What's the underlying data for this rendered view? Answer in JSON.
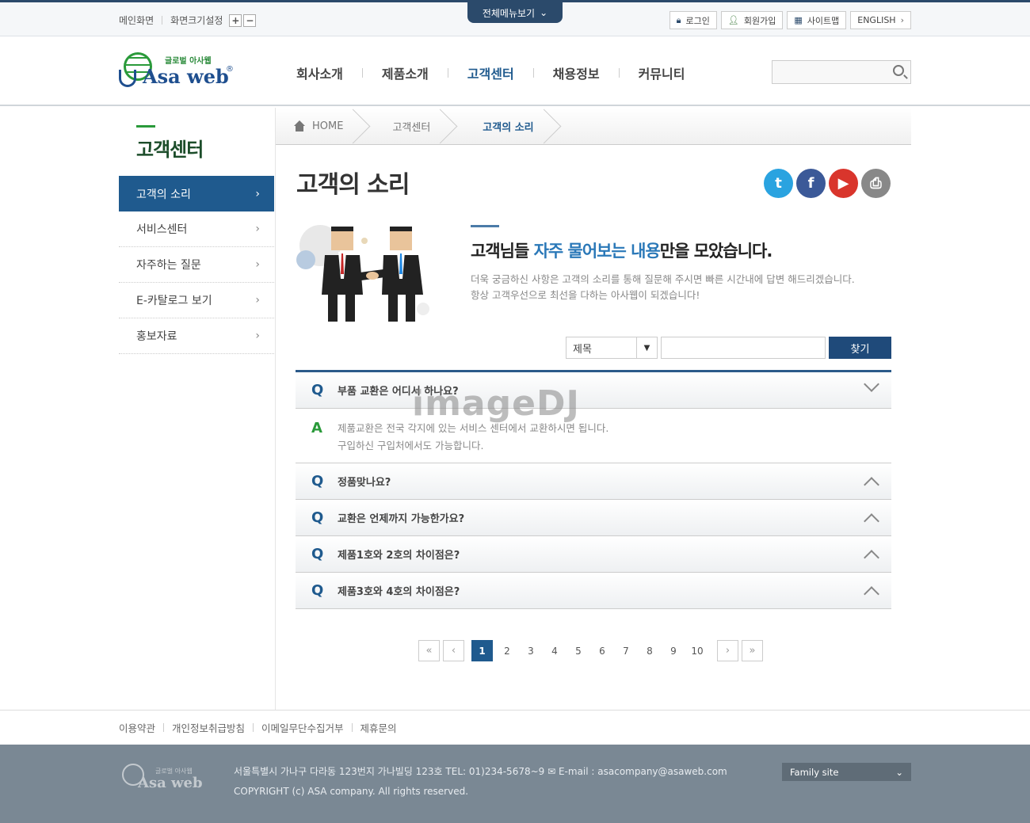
{
  "topbar": {
    "links": [
      "메인화면",
      "화면크기설정"
    ],
    "zoom_in": "+",
    "zoom_out": "−",
    "allmenu": "전체메뉴보기",
    "buttons": [
      "로그인",
      "회원가입",
      "사이트맵",
      "ENGLISH"
    ]
  },
  "logo": {
    "ko": "글로벌 아사웹",
    "en": "Asa web",
    "reg": "®"
  },
  "gnb": [
    "회사소개",
    "제품소개",
    "고객센터",
    "채용정보",
    "커뮤니티"
  ],
  "sidebar": {
    "title": "고객센터",
    "items": [
      "고객의 소리",
      "서비스센터",
      "자주하는 질문",
      "E-카탈로그 보기",
      "홍보자료"
    ]
  },
  "breadcrumb": [
    "HOME",
    "고객센터",
    "고객의 소리"
  ],
  "page_title": "고객의 소리",
  "intro": {
    "title_pre": "고객님들 ",
    "title_hl": "자주 물어보는 내용",
    "title_post": "만을 모았습니다.",
    "line1": "더욱 궁금하신 사항은 고객의 소리를 통해 질문해 주시면 빠른 시간내에 답변 해드리겠습니다.",
    "line2": "항상 고객우선으로 최선을 다하는 아사웹이 되겠습니다!"
  },
  "search": {
    "select_value": "제목",
    "button": "찾기"
  },
  "faq": {
    "q_mark": "Q",
    "a_mark": "A",
    "items": [
      {
        "q": "부품 교환은 어디서 하나요?",
        "a1": "제품교환은 전국 각지에 있는 서비스 센터에서 교환하시면 됩니다.",
        "a2": "구입하신 구입처에서도 가능합니다."
      },
      {
        "q": "정품맞나요?"
      },
      {
        "q": "교환은 언제까지 가능한가요?"
      },
      {
        "q": "제품1호와 2호의 차이점은?"
      },
      {
        "q": "제품3호와 4호의 차이점은?"
      }
    ]
  },
  "paging": {
    "first": "«",
    "prev": "‹",
    "pages": [
      "1",
      "2",
      "3",
      "4",
      "5",
      "6",
      "7",
      "8",
      "9",
      "10"
    ],
    "current": "1",
    "next": "›",
    "last": "»"
  },
  "footer": {
    "links": [
      "이용약관",
      "개인정보취급방침",
      "이메일무단수집거부",
      "제휴문의"
    ],
    "address": "서울특별시 가나구 다라동 123번지 가나빌딩 123호  TEL: 01)234-5678~9   ✉ E-mail : asacompany@asaweb.com",
    "copyright": "COPYRIGHT (c) ASA company. All rights reserved.",
    "family_site": "Family site",
    "logo_ko": "글로벌 아사웹",
    "logo_en": "Asa web"
  },
  "watermark": "imageDJ"
}
